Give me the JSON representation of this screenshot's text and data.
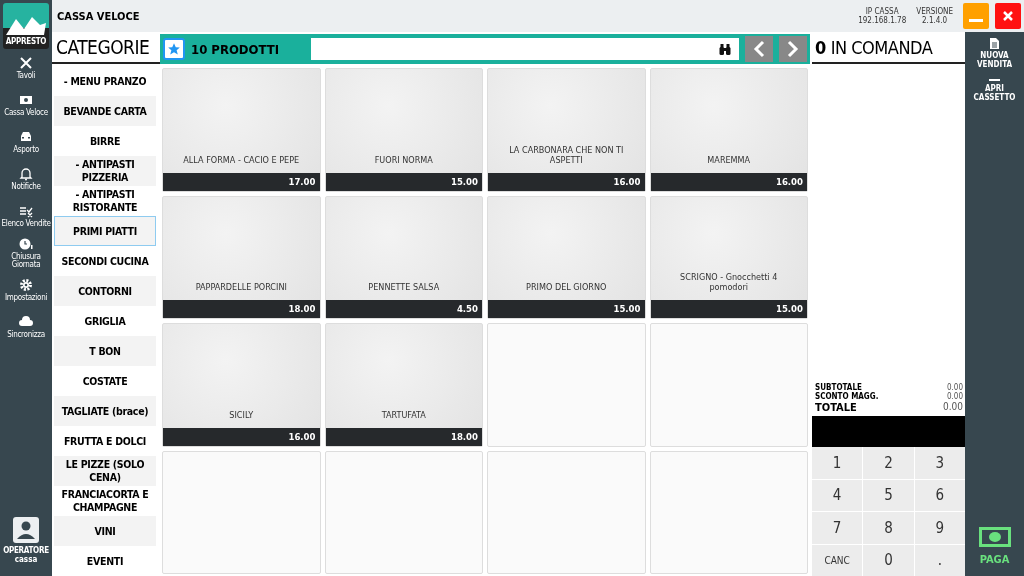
{
  "app": {
    "logo_text": "APPRESTO",
    "title": "CASSA VELOCE",
    "ip_label": "IP CASSA",
    "ip": "192.168.1.78",
    "version_label": "VERSIONE",
    "version": "2.1.4.0"
  },
  "nav": [
    {
      "label": "Tavoli"
    },
    {
      "label": "Cassa Veloce"
    },
    {
      "label": "Asporto"
    },
    {
      "label": "Notifiche"
    },
    {
      "label": "Elenco Vendite"
    },
    {
      "label": "Chiusura Giornata"
    },
    {
      "label": "Impostazioni"
    },
    {
      "label": "Sincronizza"
    }
  ],
  "operator": {
    "label": "OPERATORE",
    "name": "cassa"
  },
  "categories_title": "CATEGORIE",
  "categories": [
    {
      "label": "- MENU PRANZO",
      "selected": false
    },
    {
      "label": "BEVANDE CARTA",
      "selected": false
    },
    {
      "label": "BIRRE",
      "selected": false
    },
    {
      "label": "- ANTIPASTI PIZZERIA",
      "selected": false
    },
    {
      "label": "- ANTIPASTI RISTORANTE",
      "selected": false
    },
    {
      "label": "PRIMI PIATTI",
      "selected": true
    },
    {
      "label": "SECONDI CUCINA",
      "selected": false
    },
    {
      "label": "CONTORNI",
      "selected": false
    },
    {
      "label": "GRIGLIA",
      "selected": false
    },
    {
      "label": "T BON",
      "selected": false
    },
    {
      "label": "COSTATE",
      "selected": false
    },
    {
      "label": "TAGLIATE (brace)",
      "selected": false
    },
    {
      "label": "FRUTTA E DOLCI",
      "selected": false
    },
    {
      "label": "LE PIZZE (SOLO CENA)",
      "selected": false
    },
    {
      "label": "FRANCIACORTA E CHAMPAGNE",
      "selected": false
    },
    {
      "label": "VINI",
      "selected": false
    },
    {
      "label": "EVENTI",
      "selected": false
    }
  ],
  "products_header": {
    "count": "10 PRODOTTI"
  },
  "products": [
    {
      "name": "ALLA FORMA -  CACIO E PEPE",
      "price": "17.00"
    },
    {
      "name": "FUORI NORMA",
      "price": "15.00"
    },
    {
      "name": "LA CARBONARA CHE NON TI ASPETTI",
      "price": "16.00"
    },
    {
      "name": "MAREMMA",
      "price": "16.00"
    },
    {
      "name": "PAPPARDELLE PORCINI",
      "price": "18.00"
    },
    {
      "name": "PENNETTE SALSA",
      "price": "4.50"
    },
    {
      "name": "PRIMO DEL GIORNO",
      "price": "15.00"
    },
    {
      "name": "SCRIGNO - Gnocchetti 4 pomodori",
      "price": "15.00"
    },
    {
      "name": "SICILY",
      "price": "16.00"
    },
    {
      "name": "TARTUFATA",
      "price": "18.00"
    }
  ],
  "order": {
    "count": "0",
    "title": "IN COMANDA",
    "subtotal_label": "SUBTOTALE",
    "subtotal": "0.00",
    "discount_label": "SCONTO MAGG.",
    "discount": "0.00",
    "total_label": "TOTALE",
    "total": "0.00"
  },
  "keypad": [
    "1",
    "2",
    "3",
    "4",
    "5",
    "6",
    "7",
    "8",
    "9",
    "CANC",
    "0",
    "."
  ],
  "actions": [
    {
      "label": "NUOVA VENDITA"
    },
    {
      "label": "APRI CASSETTO"
    }
  ],
  "pay": {
    "label": "PAGA"
  }
}
